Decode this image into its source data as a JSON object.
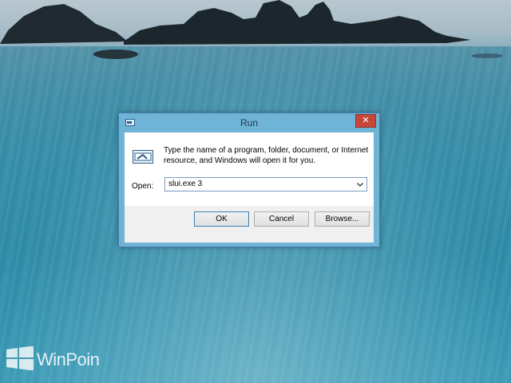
{
  "dialog": {
    "title": "Run",
    "close_glyph": "✕",
    "description": "Type the name of a program, folder, document, or Internet resource, and Windows will open it for you.",
    "open_label": "Open:",
    "open_value": "slui.exe 3",
    "buttons": {
      "ok": "OK",
      "cancel": "Cancel",
      "browse": "Browse..."
    }
  },
  "watermark": {
    "text": "WinPoin"
  },
  "colors": {
    "title_bar": "#6fb3d6",
    "close_button": "#c7463a",
    "field_border": "#7a9cc4"
  }
}
